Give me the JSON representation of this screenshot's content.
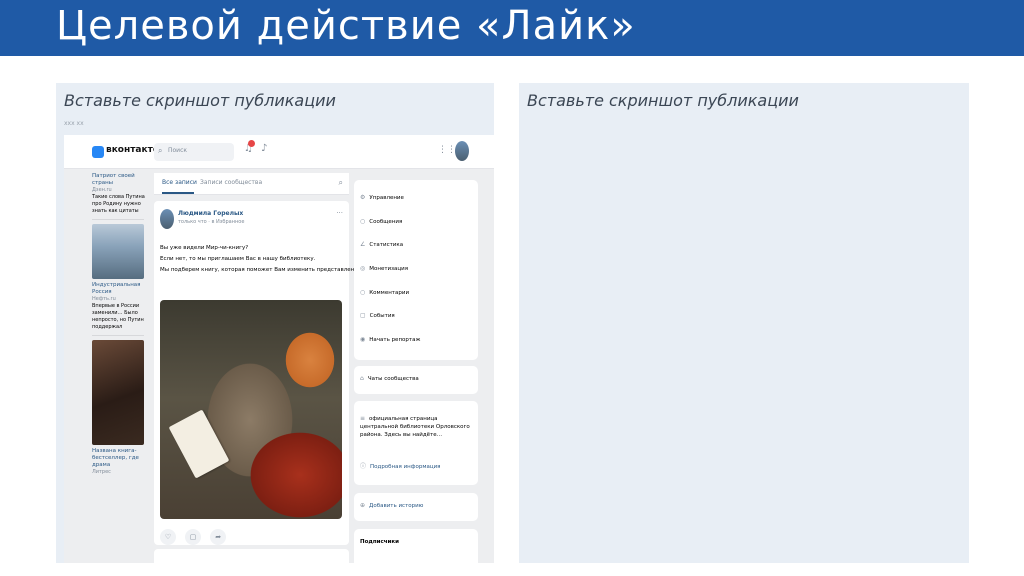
{
  "slide": {
    "title": "Целевой действие «Лайк»",
    "left_caption": "Вставьте скриншот публикации",
    "right_caption": "Вставьте скриншот публикации",
    "small_date": "xxx xx"
  },
  "vk": {
    "brand": "вконтакте",
    "search_placeholder": "Поиск",
    "notification_count": "1"
  },
  "news": [
    {
      "title": "Патриот своей страны",
      "source": "Дзен.ru",
      "text": "Такие слова Путина про Родину нужно знать как цитаты"
    },
    {
      "title": "Индустриальная Россия",
      "source": "Нефть.ru",
      "text": "Впервые в России заменили… Было непросто, но Путин поддержал"
    },
    {
      "title": "Названа книга-бестселлер, где драма",
      "source": "Литрес",
      "text": ""
    }
  ],
  "feed": {
    "tab_all": "Все записи",
    "tab_community": "Записи сообщества",
    "author": "Людмила Горелых",
    "time": "только что · в Избранное",
    "line1": "Вы уже видели Мир-чи-книгу?",
    "line2": "Если нет, то мы приглашаем Вас в нашу библиотеку.",
    "line3": "Мы подберем книгу, которая поможет Вам изменить представление о мире."
  },
  "sidebar": {
    "menu": [
      "Управление",
      "Сообщения",
      "Статистика",
      "Монетизация",
      "Комментарии",
      "События",
      "Начать репортаж"
    ],
    "community_chat": "Чаты сообщества",
    "description": "официальная страница центральной библиотеки Орловского района. Здесь вы найдёте…",
    "more_info": "Подробная информация",
    "add_story": "Добавить историю",
    "subscribers": "Подписчики"
  },
  "colors": {
    "title_bar": "#1f5aa6",
    "panel_bg": "#e8eef5",
    "vk_blue": "#2787f5"
  }
}
